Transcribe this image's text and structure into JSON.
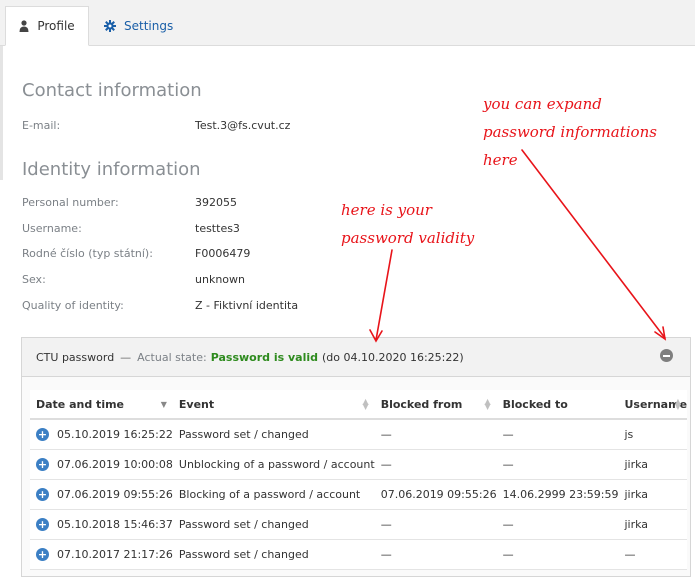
{
  "tabs": [
    {
      "label": "Profile",
      "icon": "user-icon"
    },
    {
      "label": "Settings",
      "icon": "gear-icon"
    }
  ],
  "contact": {
    "title": "Contact information",
    "email_label": "E-mail:",
    "email_value": "Test.3@fs.cvut.cz"
  },
  "identity": {
    "title": "Identity information",
    "fields": [
      {
        "label": "Personal number:",
        "value": "392055"
      },
      {
        "label": "Username:",
        "value": "testtes3"
      },
      {
        "label": "Rodné číslo (typ státní):",
        "value": "F0006479"
      },
      {
        "label": "Sex:",
        "value": "unknown"
      },
      {
        "label": "Quality of identity:",
        "value": "Z - Fiktivní identita"
      }
    ]
  },
  "password": {
    "title": "CTU password",
    "separator": "—",
    "state_label": "Actual state:",
    "state_value": "Password is valid",
    "validity": "(do 04.10.2020 16:25:22)",
    "columns": [
      "Date and time",
      "Event",
      "Blocked from",
      "Blocked to",
      "Username"
    ],
    "rows": [
      {
        "date": "05.10.2019 16:25:22",
        "event": "Password set / changed",
        "from": "—",
        "to": "—",
        "user": "js"
      },
      {
        "date": "07.06.2019 10:00:08",
        "event": "Unblocking of a password / account",
        "from": "—",
        "to": "—",
        "user": "jirka"
      },
      {
        "date": "07.06.2019 09:55:26",
        "event": "Blocking of a password / account",
        "from": "07.06.2019 09:55:26",
        "to": "14.06.2999 23:59:59",
        "user": "jirka"
      },
      {
        "date": "05.10.2018 15:46:37",
        "event": "Password set / changed",
        "from": "—",
        "to": "—",
        "user": "jirka"
      },
      {
        "date": "07.10.2017 21:17:26",
        "event": "Password set / changed",
        "from": "—",
        "to": "—",
        "user": "—"
      }
    ]
  },
  "annotations": {
    "expand_line1": "you can expand",
    "expand_line2": "password informations",
    "expand_line3": "here",
    "validity_line1": "here is your",
    "validity_line2": "password validity"
  },
  "colors": {
    "annotation": "#e8141a",
    "valid": "#2e8b1e",
    "link": "#1a5fa8",
    "expand_button": "#3b7fc4"
  }
}
